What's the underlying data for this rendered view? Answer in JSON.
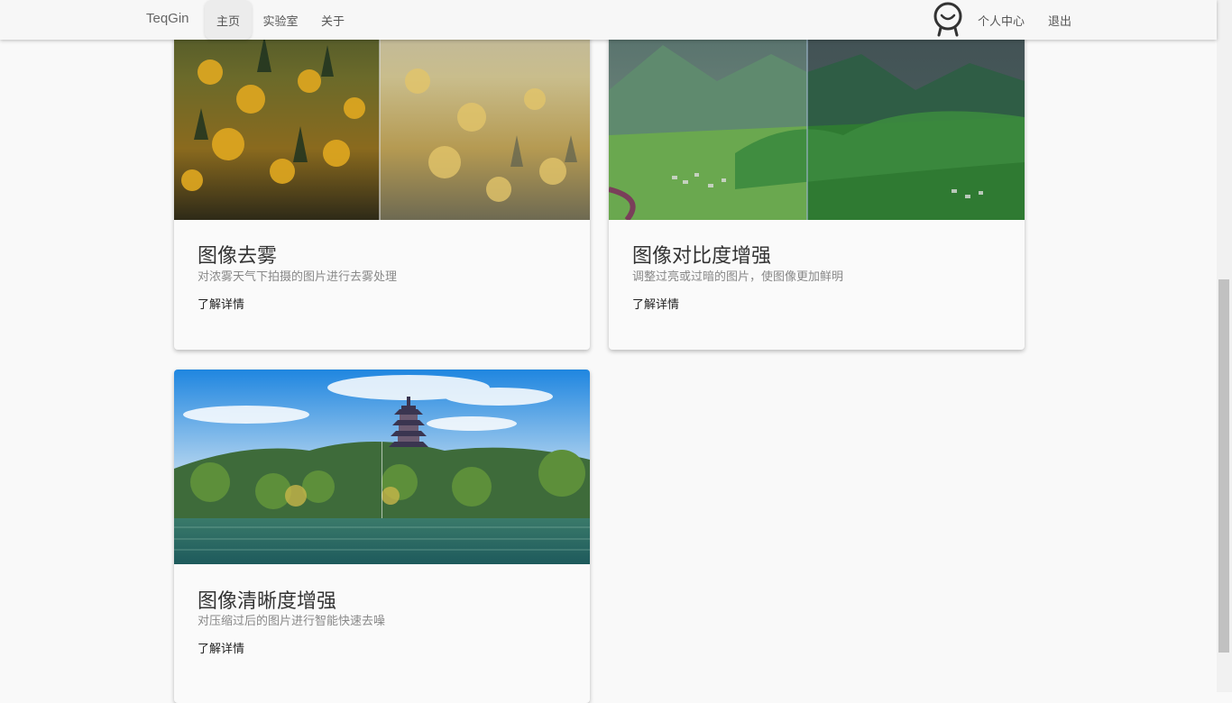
{
  "navbar": {
    "brand": "TeqGin",
    "items": [
      {
        "label": "主页",
        "active": true
      },
      {
        "label": "实验室"
      },
      {
        "label": "关于"
      }
    ],
    "profile_label": "个人中心",
    "logout_label": "退出",
    "avatar_icon": "smiley-user-icon"
  },
  "cards": [
    {
      "title": "图像去雾",
      "description": "对浓雾天气下拍摄的图片进行去雾处理",
      "link": "了解详情"
    },
    {
      "title": "图像对比度增强",
      "description": "调整过亮或过暗的图片，使图像更加鲜明",
      "link": "了解详情"
    },
    {
      "title": "图像清晰度增强",
      "description": "对压缩过后的图片进行智能快速去噪",
      "link": "了解详情"
    }
  ],
  "colors": {
    "background": "#f9f9f9",
    "navbar": "#f7f7f7",
    "active_tab": "#ececec"
  }
}
